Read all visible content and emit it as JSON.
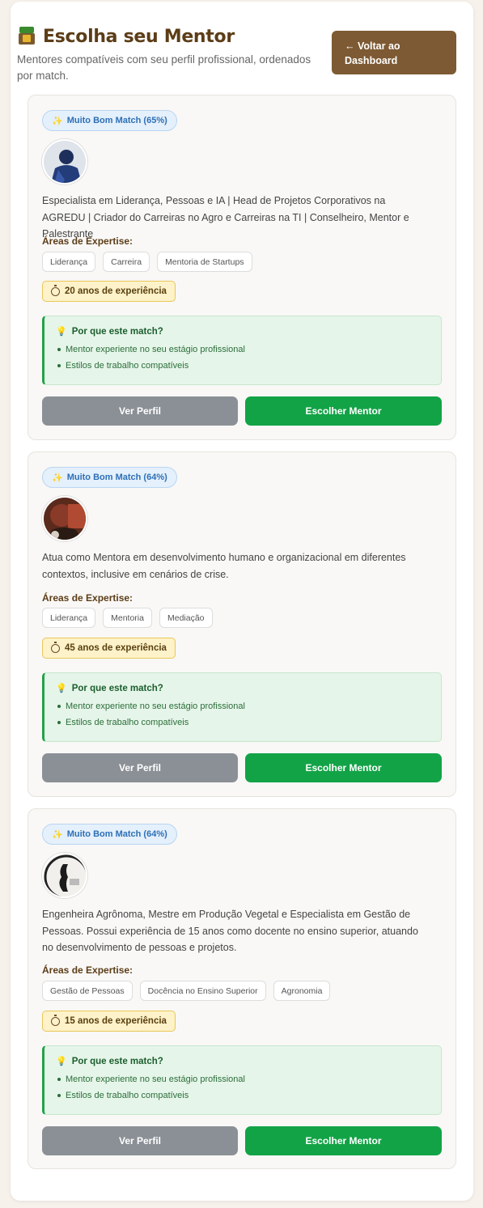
{
  "header": {
    "title": "Escolha seu Mentor",
    "subtitle": "Mentores compatíveis com seu perfil profissional, ordenados por match.",
    "back_button": "← Voltar ao Dashboard"
  },
  "labels": {
    "expertise": "Áreas de Expertise:",
    "why_match": "Por que este match?",
    "view_profile": "Ver Perfil",
    "choose_mentor": "Escolher Mentor"
  },
  "mentors": [
    {
      "match": "Muito Bom Match (65%)",
      "match_percent": 65,
      "bio": "Especialista em Liderança, Pessoas e IA | Head de Projetos Corporativos na AGREDU | Criador do Carreiras no Agro e Carreiras na TI | Conselheiro, Mentor e Palestrante",
      "tags": [
        "Liderança",
        "Carreira",
        "Mentoria de Startups"
      ],
      "years": "20 anos de experiência",
      "reasons": [
        "Mentor experiente no seu estágio profissional",
        "Estilos de trabalho compatíveis"
      ]
    },
    {
      "match": "Muito Bom Match (64%)",
      "match_percent": 64,
      "bio": "Atua como Mentora em desenvolvimento humano e organizacional em diferentes contextos, inclusive em cenários de crise.",
      "tags": [
        "Liderança",
        "Mentoria",
        "Mediação"
      ],
      "years": "45 anos de experiência",
      "reasons": [
        "Mentor experiente no seu estágio profissional",
        "Estilos de trabalho compatíveis"
      ]
    },
    {
      "match": "Muito Bom Match (64%)",
      "match_percent": 64,
      "bio": "Engenheira Agrônoma, Mestre em Produção Vegetal e Especialista em Gestão de Pessoas. Possui experiência de 15 anos como docente no ensino superior, atuando no desenvolvimento de pessoas e projetos.",
      "tags": [
        "Gestão de Pessoas",
        "Docência no Ensino Superior",
        "Agronomia"
      ],
      "years": "15 anos de experiência",
      "reasons": [
        "Mentor experiente no seu estágio profissional",
        "Estilos de trabalho compatíveis"
      ]
    }
  ]
}
